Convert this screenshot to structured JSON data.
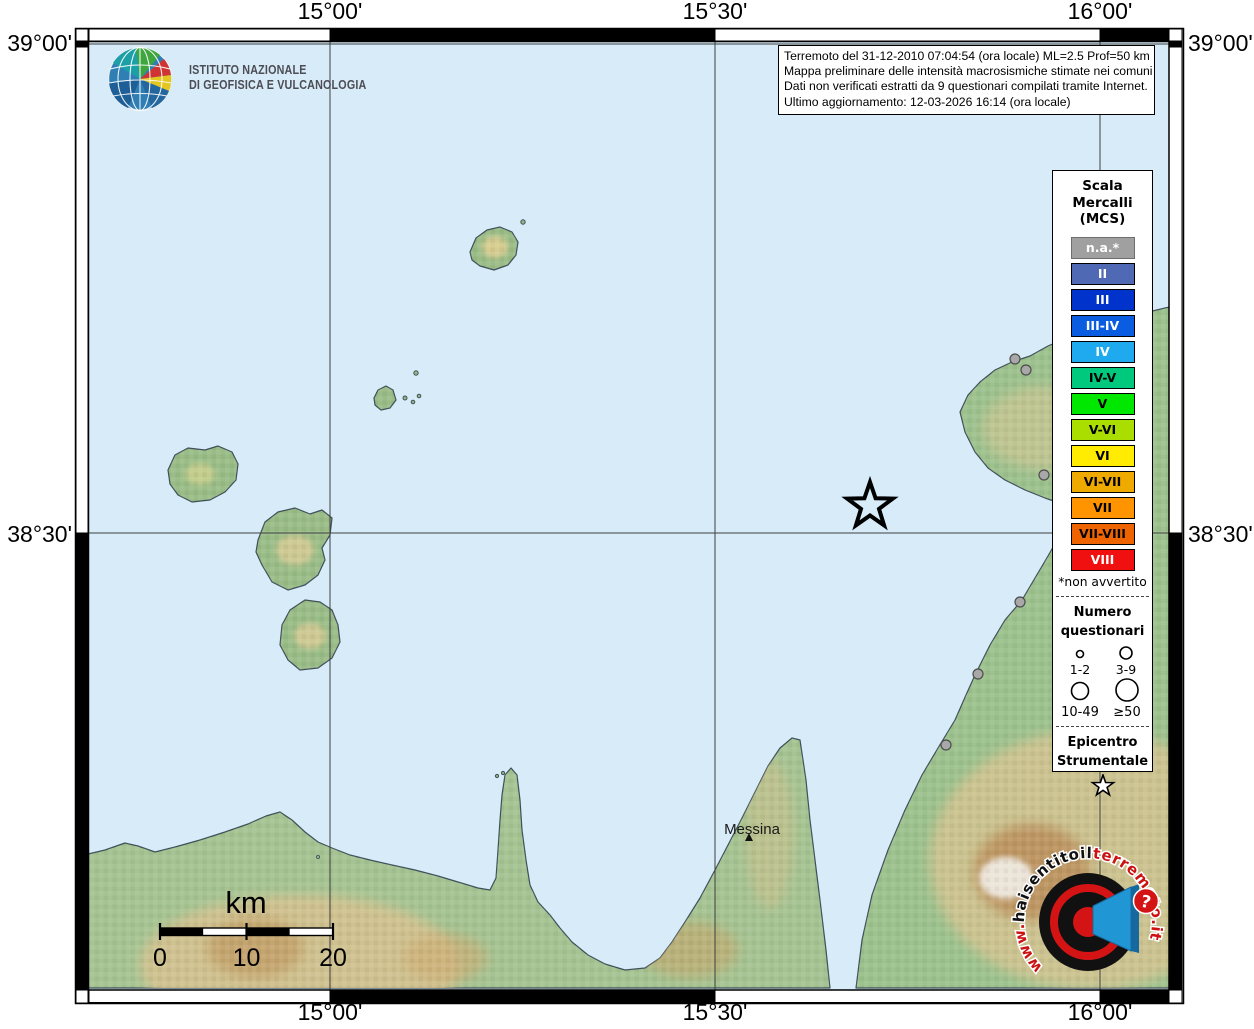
{
  "ingv": {
    "line1": "ISTITUTO NAZIONALE",
    "line2": "DI GEOFISICA E VULCANOLOGIA"
  },
  "info_box": {
    "lines": [
      "Terremoto del 31-12-2010 07:04:54 (ora locale) ML=2.5 Prof=50 km",
      "Mappa preliminare delle intensità macrosismiche stimate nei comuni",
      "Dati non verificati estratti da 9 questionari compilati tramite Internet.",
      "Ultimo aggiornamento: 12-03-2026 16:14 (ora locale)"
    ]
  },
  "axes": {
    "top": [
      "15°00'",
      "15°30'",
      "16°00'"
    ],
    "bottom": [
      "15°00'",
      "15°30'",
      "16°00'"
    ],
    "left": [
      "39°00'",
      "38°30'"
    ],
    "right": [
      "39°00'",
      "38°30'"
    ]
  },
  "map": {
    "sea_color": "#d7ebf8",
    "land_color": "#a6c493",
    "grid_color": "#3f3f3f",
    "coast_color": "#41505a",
    "settlement_dot_color": "#a8a8a8",
    "place_label": "Messina",
    "epicenter_symbol": "star"
  },
  "scale_bar": {
    "unit": "km",
    "ticks": [
      "0",
      "10",
      "20"
    ]
  },
  "legend": {
    "title": [
      "Scala",
      "Mercalli",
      "(MCS)"
    ],
    "scale_items": [
      {
        "label": "n.a.*",
        "color": "#a0a0a0",
        "text_color": "#ffffff",
        "border_color": "#6e6e6e"
      },
      {
        "label": "II",
        "color": "#4f69b5",
        "text_color": "#ffffff",
        "border_color": "#000000"
      },
      {
        "label": "III",
        "color": "#0033cc",
        "text_color": "#ffffff",
        "border_color": "#000000"
      },
      {
        "label": "III-IV",
        "color": "#0a5ce0",
        "text_color": "#ffffff",
        "border_color": "#000000"
      },
      {
        "label": "IV",
        "color": "#1fa9ee",
        "text_color": "#ffffff",
        "border_color": "#000000"
      },
      {
        "label": "IV-V",
        "color": "#00c87d",
        "text_color": "#000000",
        "border_color": "#000000"
      },
      {
        "label": "V",
        "color": "#00e800",
        "text_color": "#000000",
        "border_color": "#000000"
      },
      {
        "label": "V-VI",
        "color": "#aade00",
        "text_color": "#000000",
        "border_color": "#000000"
      },
      {
        "label": "VI",
        "color": "#ffec00",
        "text_color": "#000000",
        "border_color": "#000000"
      },
      {
        "label": "VI-VII",
        "color": "#efaa00",
        "text_color": "#000000",
        "border_color": "#000000"
      },
      {
        "label": "VII",
        "color": "#ff9400",
        "text_color": "#000000",
        "border_color": "#000000"
      },
      {
        "label": "VII-VIII",
        "color": "#f06400",
        "text_color": "#000000",
        "border_color": "#000000"
      },
      {
        "label": "VIII",
        "color": "#f01010",
        "text_color": "#ffffff",
        "border_color": "#000000"
      }
    ],
    "footnote": "*non avvertito",
    "questionnaire": {
      "title": [
        "Numero",
        "questionari"
      ],
      "classes": [
        {
          "label": "1-2"
        },
        {
          "label": "3-9"
        },
        {
          "label": "10-49"
        },
        {
          "label": "≥50"
        }
      ]
    },
    "epicenter": {
      "title": [
        "Epicentro",
        "Strumentale"
      ]
    }
  },
  "watermark": {
    "www": "www.",
    "site": "haisentitoil",
    "domain": "terremoto.it",
    "badge": "?",
    "red": "#cc1111"
  }
}
